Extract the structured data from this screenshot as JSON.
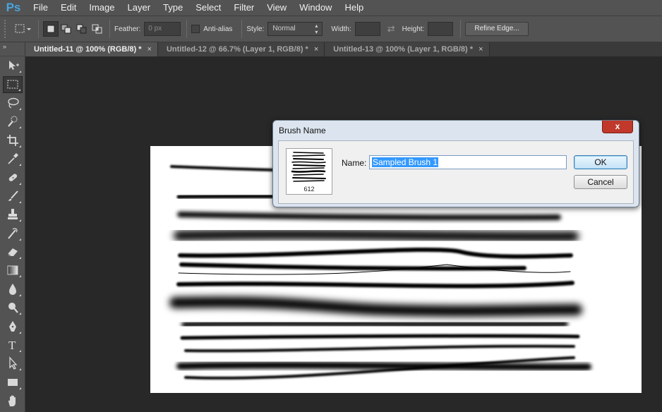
{
  "app": {
    "logo": "Ps"
  },
  "menu": [
    "File",
    "Edit",
    "Image",
    "Layer",
    "Type",
    "Select",
    "Filter",
    "View",
    "Window",
    "Help"
  ],
  "options": {
    "feather_label": "Feather:",
    "feather_value": "0 px",
    "antialias_label": "Anti-alias",
    "style_label": "Style:",
    "style_value": "Normal",
    "width_label": "Width:",
    "height_label": "Height:",
    "refine_label": "Refine Edge..."
  },
  "tabs": [
    {
      "label": "Untitled-11 @ 100% (RGB/8) *",
      "close": "×",
      "active": true
    },
    {
      "label": "Untitled-12 @ 66.7% (Layer 1, RGB/8) *",
      "close": "×",
      "active": false
    },
    {
      "label": "Untitled-13 @ 100% (Layer 1, RGB/8) *",
      "close": "×",
      "active": false
    }
  ],
  "toolbar": {
    "collapse": "»",
    "tools": [
      "move-icon",
      "marquee-icon",
      "lasso-icon",
      "quick-select-icon",
      "crop-icon",
      "eyedropper-icon",
      "healing-brush-icon",
      "brush-icon",
      "clone-stamp-icon",
      "history-brush-icon",
      "eraser-icon",
      "gradient-icon",
      "blur-icon",
      "dodge-icon",
      "pen-icon",
      "type-icon",
      "path-select-icon",
      "rectangle-icon",
      "hand-icon"
    ],
    "type_glyph": "T"
  },
  "dialog": {
    "title": "Brush Name",
    "close": "x",
    "name_label": "Name:",
    "name_value": "Sampled Brush 1",
    "brush_size": "612",
    "ok_label": "OK",
    "cancel_label": "Cancel"
  },
  "colors": {
    "ui_gray": "#535353",
    "workspace": "#282828",
    "selection": "#3399ff",
    "close_red": "#c0392b"
  }
}
